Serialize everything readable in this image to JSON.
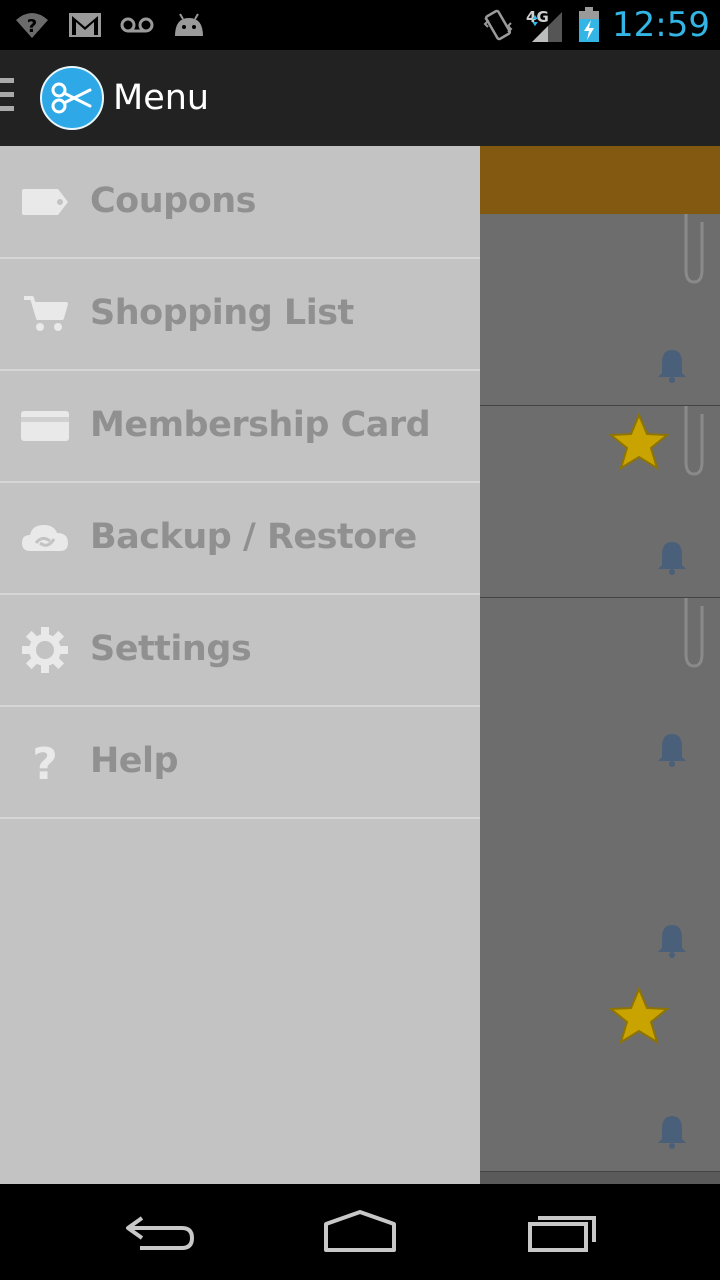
{
  "status_bar": {
    "time": "12:59",
    "network_label": "4G",
    "icons": [
      "wifi-unknown-icon",
      "gmail-icon",
      "voicemail-icon",
      "android-debug-icon",
      "vibrate-icon",
      "signal-icon",
      "battery-charging-icon"
    ]
  },
  "action_bar": {
    "title": "Menu",
    "logo_icon": "scissors-icon"
  },
  "drawer": {
    "items": [
      {
        "label": "Coupons",
        "icon": "tag-icon"
      },
      {
        "label": "Shopping List",
        "icon": "cart-icon"
      },
      {
        "label": "Membership Card",
        "icon": "card-icon"
      },
      {
        "label": "Backup / Restore",
        "icon": "cloud-sync-icon"
      },
      {
        "label": "Settings",
        "icon": "gear-icon"
      },
      {
        "label": "Help",
        "icon": "help-icon"
      }
    ]
  },
  "colors": {
    "accent": "#33b5e5",
    "drawer_bg": "#c3c3c3",
    "drawer_text": "#909090",
    "banner": "#835810",
    "star": "#c9a400"
  },
  "nav_bar": {
    "buttons": [
      "back-icon",
      "home-icon",
      "recents-icon"
    ]
  }
}
